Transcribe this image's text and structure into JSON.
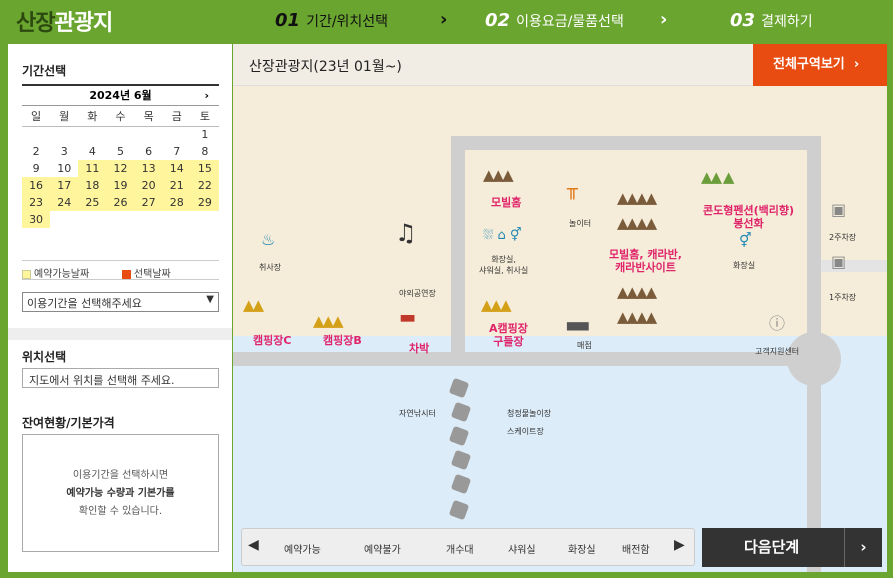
{
  "brand": {
    "a": "산장",
    "b": "관광지"
  },
  "steps": [
    {
      "num": "01",
      "label": "기간/위치선택"
    },
    {
      "num": "02",
      "label": "이용요금/물품선택"
    },
    {
      "num": "03",
      "label": "결제하기"
    }
  ],
  "side": {
    "period_title": "기간선택",
    "calendar_title": "2024년  6월",
    "weekdays": [
      "일",
      "월",
      "화",
      "수",
      "목",
      "금",
      "토"
    ],
    "weeks": [
      [
        "",
        "",
        "",
        "",
        "",
        "",
        "1"
      ],
      [
        "2",
        "3",
        "4",
        "5",
        "6",
        "7",
        "8"
      ],
      [
        "9",
        "10",
        "11",
        "12",
        "13",
        "14",
        "15"
      ],
      [
        "16",
        "17",
        "18",
        "19",
        "20",
        "21",
        "22"
      ],
      [
        "23",
        "24",
        "25",
        "26",
        "27",
        "28",
        "29"
      ],
      [
        "30",
        "",
        "",
        "",
        "",
        "",
        ""
      ]
    ],
    "legend_available": "예약가능날짜",
    "legend_selected": "선택날짜",
    "period_select": "이용기간을 선택해주세요",
    "location_title": "위치선택",
    "location_text": "지도에서 위치를 선택해 주세요.",
    "remain_title": "잔여현황/기본가격",
    "remain_l1": "이용기간을 선택하시면",
    "remain_l2": "예약가능 수량과 기본가를",
    "remain_l3": "확인할 수 있습니다."
  },
  "main": {
    "title": "산장관광지(23년 01월~)",
    "full_button": "전체구역보기",
    "next_button": "다음단계"
  },
  "map": {
    "mobile_home": "모빌홈",
    "playground": "놀이터",
    "mobile_caravan": "모빌홈, 캐라반,\n캐라반사이트",
    "condo": "콘도형펜션(백리향)\n봉선화",
    "parking2": "2주차장",
    "parking1": "1주차장",
    "cooking": "취사장",
    "outdoor_stage": "야외공연장",
    "facilities": "화장실,\n샤워실, 취사실",
    "toilet": "화장실",
    "camp_c": "캠핑장C",
    "camp_b": "캠핑장B",
    "chabak": "차박",
    "camp_a": "A캠핑장\n구들장",
    "store": "매점",
    "support": "고객지원센터",
    "fishing": "자연낚시터",
    "sled": "청정물놀이장",
    "skate": "스케이트장"
  },
  "legend_bar": [
    "예약가능",
    "예약불가",
    "개수대",
    "샤워실",
    "화장실",
    "배전함"
  ],
  "colors": {
    "green": "#6aa52f",
    "orange": "#e84c11",
    "label": "#e0246a",
    "available": "#fff59d"
  }
}
